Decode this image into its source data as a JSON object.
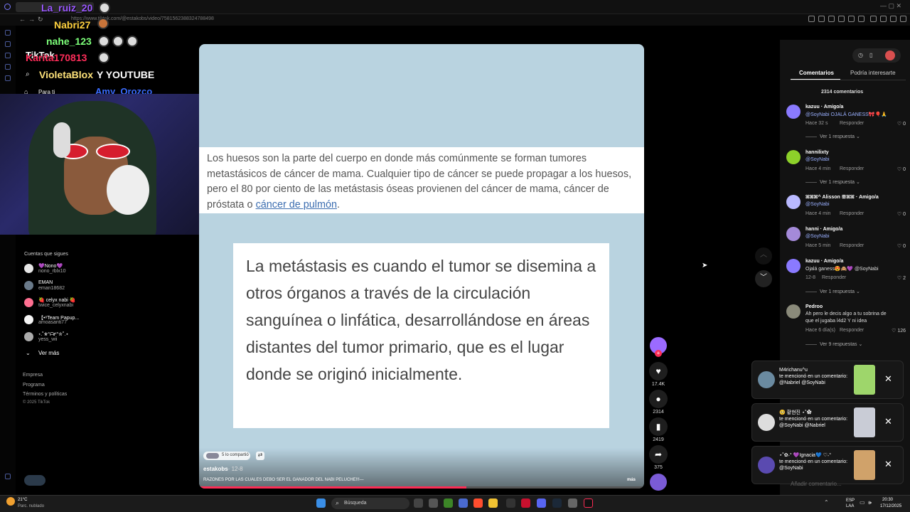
{
  "browser": {
    "url": "https://www.tiktok.com/@estakobs/video/7581562388324788498"
  },
  "chat_overlay": {
    "lines": [
      {
        "user": "La_ruiz_20",
        "color": "#9b59ff"
      },
      {
        "user": "Nabri27",
        "color": "#ffd23f"
      },
      {
        "user": "nahe_123",
        "color": "#7dff7a"
      },
      {
        "user": "Karita170813",
        "color": "#ff2d5a"
      },
      {
        "user": "VioletaBlox",
        "color": "#ffe37a"
      },
      {
        "user": "Amy_Orozco",
        "color": "#3a6cff"
      }
    ],
    "message_fragment": "Y YOUTUBE"
  },
  "sidebar": {
    "logo": "TikTok",
    "nav_for_you": "Para ti",
    "following_title": "Cuentas que sigues",
    "following": [
      {
        "name": "💜Nono💜",
        "user": "nono_rblx10"
      },
      {
        "name": "EMAN",
        "user": "eman18682"
      },
      {
        "name": "🍓 celyx nabi 🍓",
        "user": "twice_celyxnabi"
      },
      {
        "name": "【•ᵒTeam Papup...",
        "user": "amoasanti77"
      },
      {
        "name": "⋆.˚✮°ᗩrᶦ°✮˚.⋆",
        "user": "yess_wii"
      }
    ],
    "see_more": "Ver más",
    "footer": [
      "Empresa",
      "Programa",
      "Términos y políticas",
      "© 2025 TikTok"
    ]
  },
  "video": {
    "article_text": "Los huesos son la parte del cuerpo en donde más comúnmente se forman tumores metastásicos de cáncer de mama. Cualquier tipo de cáncer se puede propagar a los huesos, pero el 80 por ciento de las metástasis óseas provienen del cáncer de mama, cáncer de próstata o ",
    "article_link": "cáncer de pulmón",
    "article_end": ".",
    "quote": "La metástasis es cuando el tumor se disemina a otros órganos a través de la circulación sanguínea o linfática, desarrollándose en áreas distantes del tumor primario, que es el lugar donde se originó inicialmente.",
    "shared_by": "5 lo compartió",
    "author": "estakobs",
    "date": "· 12-8",
    "caption": "RAZONES POR LAS CUALES DEBO SER EL GANADOR DEL NABI PELUCHE!!!—",
    "more": "más",
    "progress": 0.6
  },
  "actions": {
    "likes": "17.4K",
    "comments": "2314",
    "saves": "2419",
    "shares": "375"
  },
  "panel": {
    "tab_comments": "Comentarios",
    "tab_interest": "Podría interesarte",
    "count": "2314 comentarios",
    "reply_label": "Responder",
    "comments": [
      {
        "name": "kazuu · Amigo/a",
        "text": "@SoyNabi OJALÁ GANESS🎀🎈🙏",
        "meta": "Hace 32 s",
        "likes": "0",
        "color": "#8a7aff"
      },
      {
        "name": "hannilixty",
        "text": "@SoyNabi",
        "meta": "Hace 4 min",
        "likes": "0",
        "color": "#8dd12a"
      },
      {
        "name": "ꕤꕤꕤ^ Alisson ꕥꕤꕤ · Amigo/a",
        "text": "@SoyNabi",
        "meta": "Hace 4 min",
        "likes": "0",
        "color": "#b9b9ff"
      },
      {
        "name": "hanni · Amigo/a",
        "text": "@SoyNabi",
        "meta": "Hace 5 min",
        "likes": "0",
        "color": "#a48ad9"
      },
      {
        "name": "kazuu · Amigo/a",
        "text": "Ojalá ganess😍🙈💜 @SoyNabi",
        "meta": "12-8",
        "likes": "2",
        "color": "#8a7aff"
      },
      {
        "name": "Pedroo",
        "text": "Ah pero le decis algo a tu sobrina de",
        "text2": "que el jugaba l4d2 Y ni idea",
        "meta": "Hace 6 día(s)",
        "likes": "126",
        "color": "#8a8a7a"
      }
    ],
    "replies_1": "Ver 1 respuesta ⌄",
    "replies_9": "Ver 9 respuestas ⌄",
    "add_comment": "Añadir comentario..."
  },
  "notifications": [
    {
      "name": "M4richanu^u",
      "text": "te mencionó en un comentario: @Nabriel @SoyNabi"
    },
    {
      "name": "🥺 황현진 ⋆˚✿",
      "text": "te mencionó en un comentario: @SoyNabi @Nabriel"
    },
    {
      "name": "⋆˚✿˖° 💜Ignacia💙 ♡˖°",
      "text": "te mencionó en un comentario: @SoyNabi"
    }
  ],
  "taskbar": {
    "weather_temp": "21°C",
    "weather_desc": "Parc. nublado",
    "search": "Búsqueda",
    "lang": "ESP",
    "lang2": "LAA",
    "time": "20:30",
    "date": "17/12/2025"
  }
}
